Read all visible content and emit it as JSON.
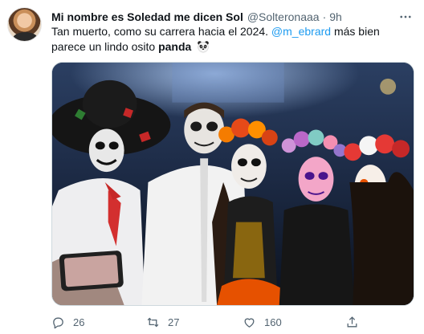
{
  "tweet": {
    "author_name": "Mi nombre es Soledad me dicen Sol",
    "handle": "@Solteronaaa",
    "separator": "·",
    "time": "9h",
    "text_part1": "Tan muerto, como su carrera hacia el 2024.",
    "mention": "@m_ebrard",
    "text_part2": "más bien parece un lindo osito",
    "bold_word": "panda",
    "emoji_name": "panda-emoji"
  },
  "actions": {
    "reply_count": "26",
    "retweet_count": "27",
    "like_count": "160"
  },
  "icons": {
    "more": "more-horizontal-icon",
    "reply": "reply-icon",
    "retweet": "retweet-icon",
    "like": "heart-icon",
    "share": "share-icon"
  },
  "colors": {
    "mention": "#1d9bf0",
    "secondary_text": "#536471",
    "primary_text": "#0f1419"
  }
}
